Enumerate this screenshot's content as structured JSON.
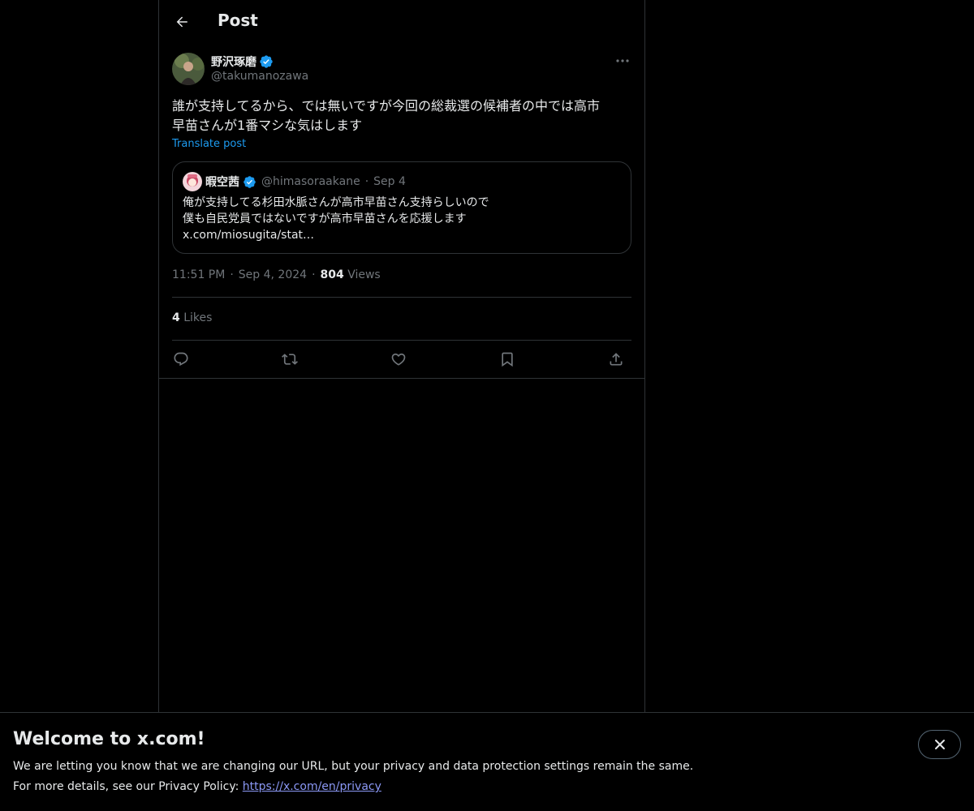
{
  "header": {
    "title": "Post"
  },
  "post": {
    "author_name": "野沢琢磨",
    "author_handle": "@takumanozawa",
    "text_line1": "誰が支持してるから、では無いですが今回の総裁選の候補者の中では高市",
    "text_line2": "早苗さんが1番マシな気はします",
    "translate_label": "Translate post",
    "time": "11:51 PM",
    "date": "Sep 4, 2024",
    "views_count": "804",
    "views_label": "Views",
    "likes_count": "4",
    "likes_label": "Likes"
  },
  "quote": {
    "author_name": "暇空茜",
    "author_handle": "@himasoraakane",
    "date": "Sep 4",
    "line1": "俺が支持してる杉田水脈さんが高市早苗さん支持らしいので",
    "line2": "僕も自民党員ではないですが高市早苗さんを応援します",
    "line3": "x.com/miosugita/stat…"
  },
  "banner": {
    "title": "Welcome to x.com!",
    "line1": "We are letting you know that we are changing our URL, but your privacy and data protection settings remain the same.",
    "line2_prefix": "For more details, see our Privacy Policy: ",
    "link": "https://x.com/en/privacy"
  },
  "colors": {
    "accent": "#1d9bf0",
    "verified": "#1d9bf0",
    "muted": "#71767b",
    "border": "#2f3336",
    "link": "#8b98f5"
  },
  "icons": [
    "back-arrow-icon",
    "verified-badge-icon",
    "more-icon",
    "reply-icon",
    "repost-icon",
    "like-icon",
    "bookmark-icon",
    "share-icon",
    "close-icon"
  ]
}
